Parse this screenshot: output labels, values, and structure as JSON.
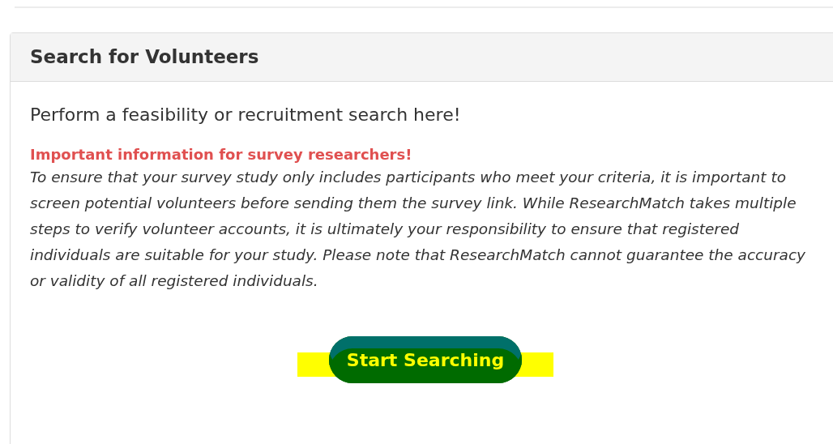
{
  "panel": {
    "title": "Search for Volunteers",
    "intro": "Perform a feasibility or recruitment search here!",
    "notice": {
      "heading": "Important information for survey researchers!",
      "body": "To ensure that your survey study only includes participants who meet your criteria, it is important to screen potential volunteers before sending them the survey link. While ResearchMatch takes multiple steps to verify volunteer accounts, it is ultimately your responsibility to ensure that registered individuals are suitable for your study. Please note that ResearchMatch cannot guarantee the accuracy or validity of all registered individuals."
    },
    "button": {
      "label": "Start Searching",
      "highlighted": true
    }
  }
}
